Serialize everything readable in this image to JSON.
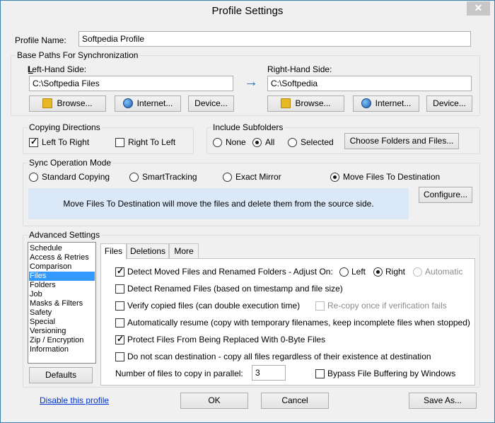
{
  "window": {
    "title": "Profile Settings",
    "close_glyph": "✕"
  },
  "profile": {
    "label": "Profile Name:",
    "value": "Softpedia Profile"
  },
  "base_paths": {
    "legend": "Base Paths For Synchronization",
    "left": {
      "label": "Left-Hand Side:",
      "value": "C:\\Softpedia Files",
      "browse": "Browse...",
      "internet": "Internet...",
      "device": "Device..."
    },
    "right": {
      "label": "Right-Hand Side:",
      "value": "C:\\Softpedia",
      "browse": "Browse...",
      "internet": "Internet...",
      "device": "Device..."
    },
    "arrow": "→"
  },
  "copying_directions": {
    "legend": "Copying Directions",
    "left_to_right": {
      "label": "Left To Right",
      "checked": true
    },
    "right_to_left": {
      "label": "Right To Left",
      "checked": false
    }
  },
  "include_subfolders": {
    "legend": "Include Subfolders",
    "options": [
      "None",
      "All",
      "Selected"
    ],
    "selected": "All",
    "choose_button": "Choose Folders and Files..."
  },
  "sync_mode": {
    "legend": "Sync Operation Mode",
    "options": [
      "Standard Copying",
      "SmartTracking",
      "Exact Mirror",
      "Move Files To Destination"
    ],
    "selected": "Move Files To Destination",
    "description": "Move Files To Destination will move the files and delete them from the source side.",
    "configure_button": "Configure..."
  },
  "advanced": {
    "legend": "Advanced Settings",
    "categories": [
      "Schedule",
      "Access & Retries",
      "Comparison",
      "Files",
      "Folders",
      "Job",
      "Masks & Filters",
      "Safety",
      "Special",
      "Versioning",
      "Zip / Encryption",
      "Information"
    ],
    "selected_category": "Files",
    "defaults_button": "Defaults",
    "tabs": [
      "Files",
      "Deletions",
      "More"
    ],
    "active_tab": "Files",
    "files": {
      "detect_moved": {
        "label": "Detect Moved Files and Renamed Folders - Adjust On:",
        "checked": true
      },
      "adjust_options": [
        "Left",
        "Right",
        "Automatic"
      ],
      "adjust_selected": "Right",
      "detect_renamed": {
        "label": "Detect Renamed Files (based on timestamp and file size)",
        "checked": false
      },
      "verify": {
        "label": "Verify copied files (can double execution time)",
        "checked": false
      },
      "recopy": {
        "label": "Re-copy once if verification fails",
        "checked": false
      },
      "auto_resume": {
        "label": "Automatically resume (copy with temporary filenames, keep incomplete files when stopped)",
        "checked": false
      },
      "protect": {
        "label": "Protect Files From Being Replaced With 0-Byte Files",
        "checked": true
      },
      "no_scan": {
        "label": "Do not scan destination - copy all files regardless of their existence at destination",
        "checked": false
      },
      "parallel_label": "Number of files to copy in parallel:",
      "parallel_value": "3",
      "bypass": {
        "label": "Bypass File Buffering by Windows",
        "checked": false
      }
    }
  },
  "footer": {
    "disable_link": "Disable this profile",
    "ok": "OK",
    "cancel": "Cancel",
    "save_as": "Save As..."
  }
}
